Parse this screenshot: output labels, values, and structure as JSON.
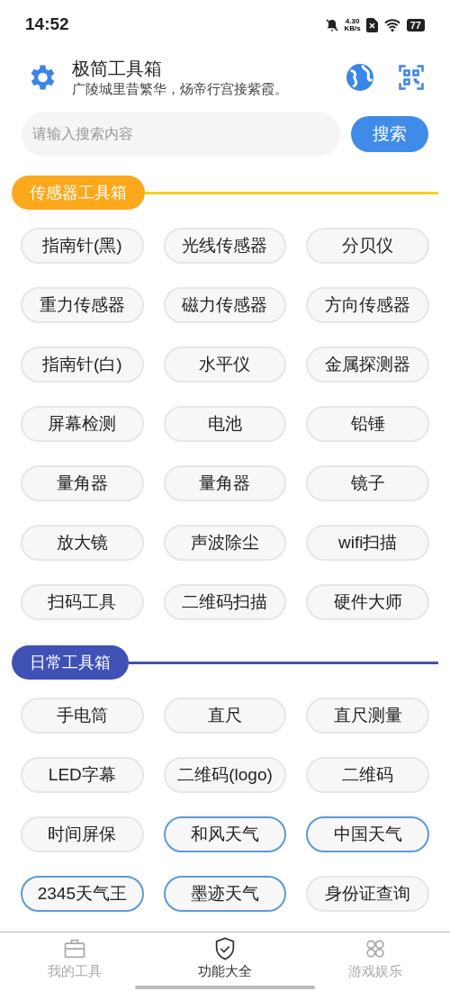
{
  "status_bar": {
    "time": "14:52",
    "speed_value": "4.30",
    "speed_unit": "KB/s",
    "battery": "77"
  },
  "header": {
    "title": "极简工具箱",
    "subtitle": "广陵城里昔繁华，炀帝行宫接紫霞。"
  },
  "search": {
    "placeholder": "请输入搜索内容",
    "button": "搜索"
  },
  "sections": [
    {
      "title": "传感器工具箱",
      "color": "#fba81c",
      "line": {
        "color": "#f3d31c"
      },
      "tools": [
        {
          "label": "指南针(黑)",
          "highlighted": false
        },
        {
          "label": "光线传感器",
          "highlighted": false
        },
        {
          "label": "分贝仪",
          "highlighted": false
        },
        {
          "label": "重力传感器",
          "highlighted": false
        },
        {
          "label": "磁力传感器",
          "highlighted": false
        },
        {
          "label": "方向传感器",
          "highlighted": false
        },
        {
          "label": "指南针(白)",
          "highlighted": false
        },
        {
          "label": "水平仪",
          "highlighted": false
        },
        {
          "label": "金属探测器",
          "highlighted": false
        },
        {
          "label": "屏幕检测",
          "highlighted": false
        },
        {
          "label": "电池",
          "highlighted": false
        },
        {
          "label": "铅锤",
          "highlighted": false
        },
        {
          "label": "量角器",
          "highlighted": false
        },
        {
          "label": "量角器",
          "highlighted": false
        },
        {
          "label": "镜子",
          "highlighted": false
        },
        {
          "label": "放大镜",
          "highlighted": false
        },
        {
          "label": "声波除尘",
          "highlighted": false
        },
        {
          "label": "wifi扫描",
          "highlighted": false
        },
        {
          "label": "扫码工具",
          "highlighted": false
        },
        {
          "label": "二维码扫描",
          "highlighted": false
        },
        {
          "label": "硬件大师",
          "highlighted": false
        }
      ]
    },
    {
      "title": "日常工具箱",
      "color": "#3f51b5",
      "line": {
        "color": "#3f51b5"
      },
      "tools": [
        {
          "label": "手电筒",
          "highlighted": false
        },
        {
          "label": "直尺",
          "highlighted": false
        },
        {
          "label": "直尺测量",
          "highlighted": false
        },
        {
          "label": "LED字幕",
          "highlighted": false
        },
        {
          "label": "二维码(logo)",
          "highlighted": false
        },
        {
          "label": "二维码",
          "highlighted": false
        },
        {
          "label": "时间屏保",
          "highlighted": false
        },
        {
          "label": "和风天气",
          "highlighted": true
        },
        {
          "label": "中国天气",
          "highlighted": true
        },
        {
          "label": "2345天气王",
          "highlighted": true
        },
        {
          "label": "墨迹天气",
          "highlighted": true
        },
        {
          "label": "身份证查询",
          "highlighted": false
        }
      ]
    }
  ],
  "nav": [
    {
      "label": "我的工具",
      "kind": "toolbox",
      "selected": false
    },
    {
      "label": "功能大全",
      "kind": "shield",
      "selected": true
    },
    {
      "label": "游戏娱乐",
      "kind": "grid",
      "selected": false
    }
  ]
}
